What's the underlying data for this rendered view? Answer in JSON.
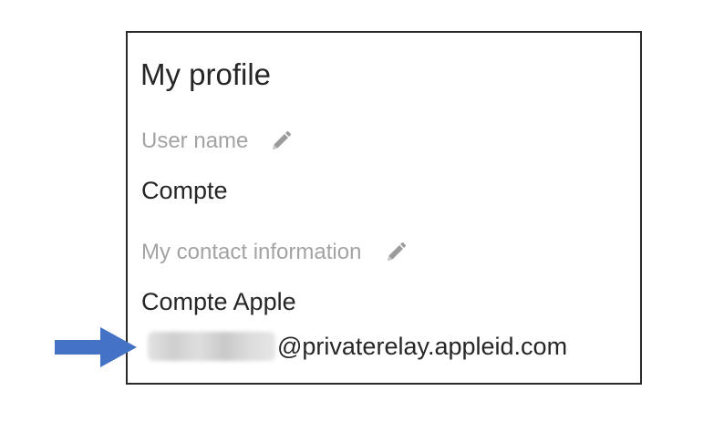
{
  "profile": {
    "title": "My profile",
    "user_name_label": "User name",
    "user_name_value": "Compte",
    "contact_label": "My contact information",
    "contact_value": "Compte Apple",
    "email_domain": "@privaterelay.appleid.com"
  },
  "icons": {
    "user_name_edit": "pencil-icon",
    "contact_edit": "pencil-icon",
    "annotation": "right-arrow-icon"
  },
  "colors": {
    "arrow": "#4472c4",
    "label": "#a3a3a3",
    "text": "#262626",
    "border": "#2a2a2a"
  }
}
